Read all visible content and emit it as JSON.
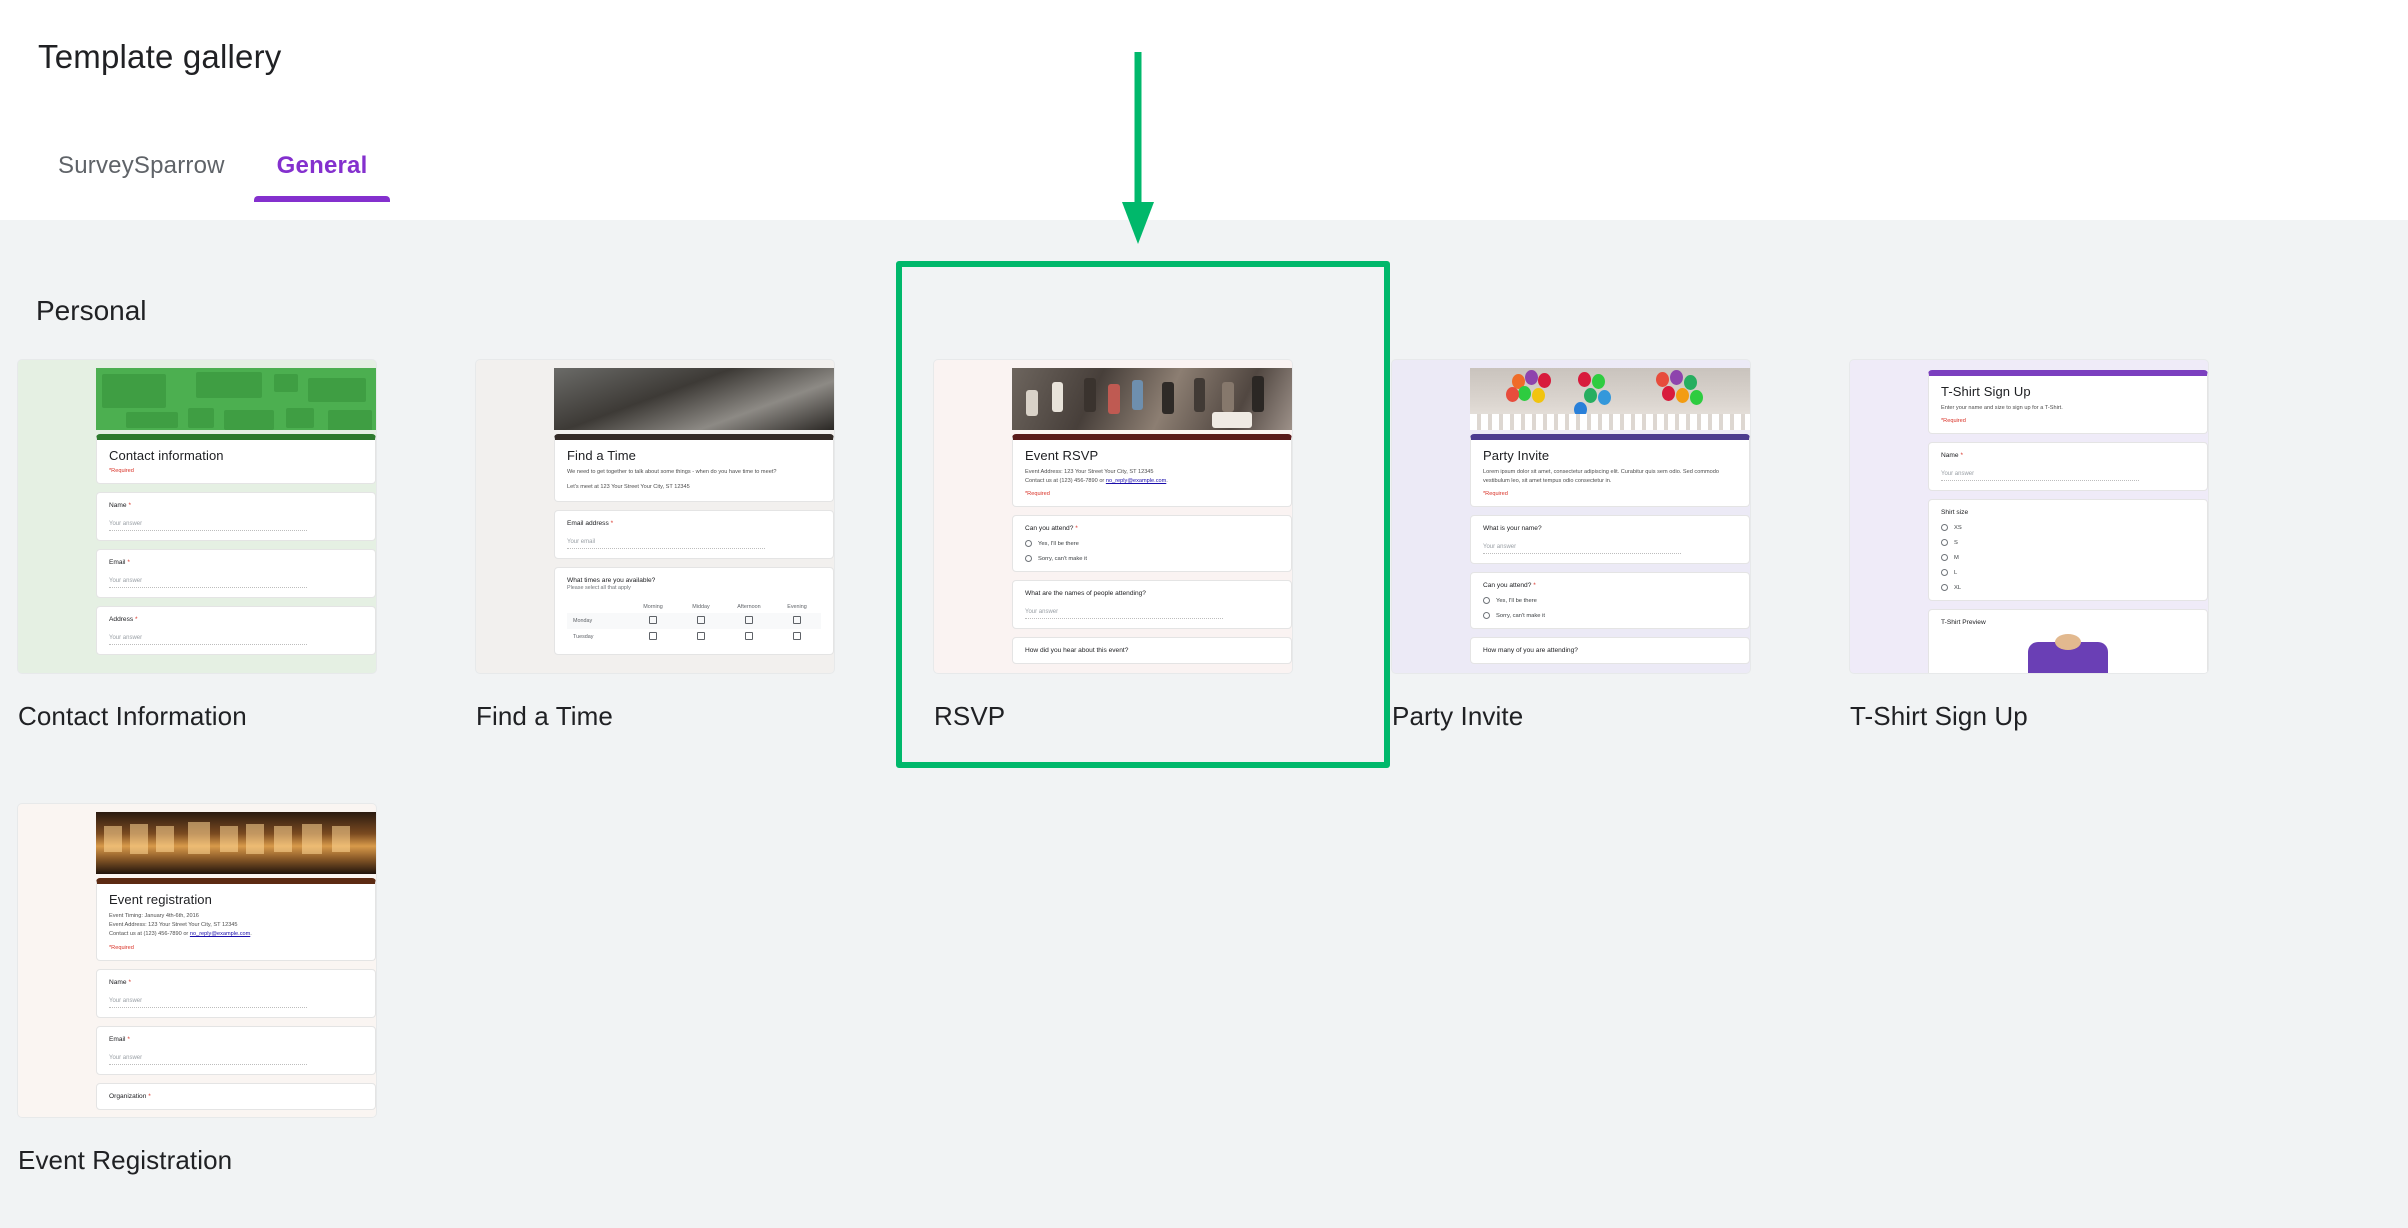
{
  "header": {
    "title": "Template gallery",
    "tabs": [
      {
        "label": "SurveySparrow",
        "active": false
      },
      {
        "label": "General",
        "active": true
      }
    ]
  },
  "colors": {
    "accent_purple": "#8430ce",
    "annotation_green": "#00b86b",
    "background": "#f1f3f4",
    "surface": "#ffffff",
    "required_red": "#d93025"
  },
  "main": {
    "section_title": "Personal",
    "templates": [
      {
        "label": "Contact Information",
        "theme": "green",
        "form": {
          "title": "Contact information",
          "required_note": "*Required",
          "questions": [
            {
              "label": "Name",
              "required": true,
              "answer_placeholder": "Your answer"
            },
            {
              "label": "Email",
              "required": true,
              "answer_placeholder": "Your answer"
            },
            {
              "label": "Address",
              "required": true,
              "answer_placeholder": "Your answer"
            }
          ]
        }
      },
      {
        "label": "Find a Time",
        "theme": "grey",
        "form": {
          "title": "Find a Time",
          "description_1": "We need to get together to talk about some things - when do you have time to meet?",
          "description_2": "Let's meet at 123 Your Street Your City, ST 12345",
          "questions": [
            {
              "label": "Email address",
              "required": true,
              "answer_placeholder": "Your email"
            }
          ],
          "grid_question": {
            "label": "What times are you available?",
            "sub_label": "Please select all that apply",
            "columns": [
              "Morning",
              "Midday",
              "Afternoon",
              "Evening"
            ],
            "rows": [
              "Monday",
              "Tuesday"
            ]
          }
        }
      },
      {
        "label": "RSVP",
        "theme": "rsvp",
        "highlighted": true,
        "form": {
          "title": "Event RSVP",
          "description_1": "Event Address: 123 Your Street Your City, ST 12345",
          "description_2_prefix": "Contact us at (123) 456-7890 or ",
          "description_2_link": "no_reply@example.com",
          "description_2_suffix": ".",
          "required_note": "*Required",
          "questions": [
            {
              "label": "Can you attend?",
              "required": true,
              "options": [
                "Yes, I'll be there",
                "Sorry, can't make it"
              ]
            },
            {
              "label": "What are the names of people attending?",
              "required": false,
              "answer_placeholder": "Your answer"
            },
            {
              "label": "How did you hear about this event?",
              "required": false
            }
          ]
        }
      },
      {
        "label": "Party Invite",
        "theme": "purple",
        "form": {
          "title": "Party Invite",
          "description_1": "Lorem ipsum dolor sit amet, consectetur adipiscing elit. Curabitur quis sem odio. Sed commodo vestibulum leo, sit amet tempus odio consectetur in.",
          "required_note": "*Required",
          "questions": [
            {
              "label": "What is your name?",
              "required": false,
              "answer_placeholder": "Your answer"
            },
            {
              "label": "Can you attend?",
              "required": true,
              "options": [
                "Yes, I'll be there",
                "Sorry, can't make it"
              ]
            },
            {
              "label": "How many of you are attending?",
              "required": false
            }
          ]
        }
      },
      {
        "label": "T-Shirt Sign Up",
        "theme": "lavender",
        "form": {
          "title": "T-Shirt Sign Up",
          "description_1": "Enter your name and size to sign up for a T-Shirt.",
          "required_note": "*Required",
          "questions": [
            {
              "label": "Name",
              "required": true,
              "answer_placeholder": "Your answer"
            },
            {
              "label": "Shirt size",
              "required": false,
              "options": [
                "XS",
                "S",
                "M",
                "L",
                "XL"
              ]
            },
            {
              "label": "T-Shirt Preview",
              "required": false
            }
          ]
        }
      },
      {
        "label": "Event Registration",
        "theme": "event",
        "form": {
          "title": "Event registration",
          "description_1": "Event Timing: January 4th-6th, 2016",
          "description_2": "Event Address: 123 Your Street Your City, ST 12345",
          "description_3_prefix": "Contact us at (123) 456-7890 or ",
          "description_3_link": "no_reply@example.com",
          "description_3_suffix": ".",
          "required_note": "*Required",
          "questions": [
            {
              "label": "Name",
              "required": true,
              "answer_placeholder": "Your answer"
            },
            {
              "label": "Email",
              "required": true,
              "answer_placeholder": "Your answer"
            },
            {
              "label": "Organization",
              "required": true
            }
          ]
        }
      }
    ]
  },
  "annotation": {
    "highlight_target": "RSVP",
    "arrow_direction": "down",
    "color": "#00b86b"
  }
}
